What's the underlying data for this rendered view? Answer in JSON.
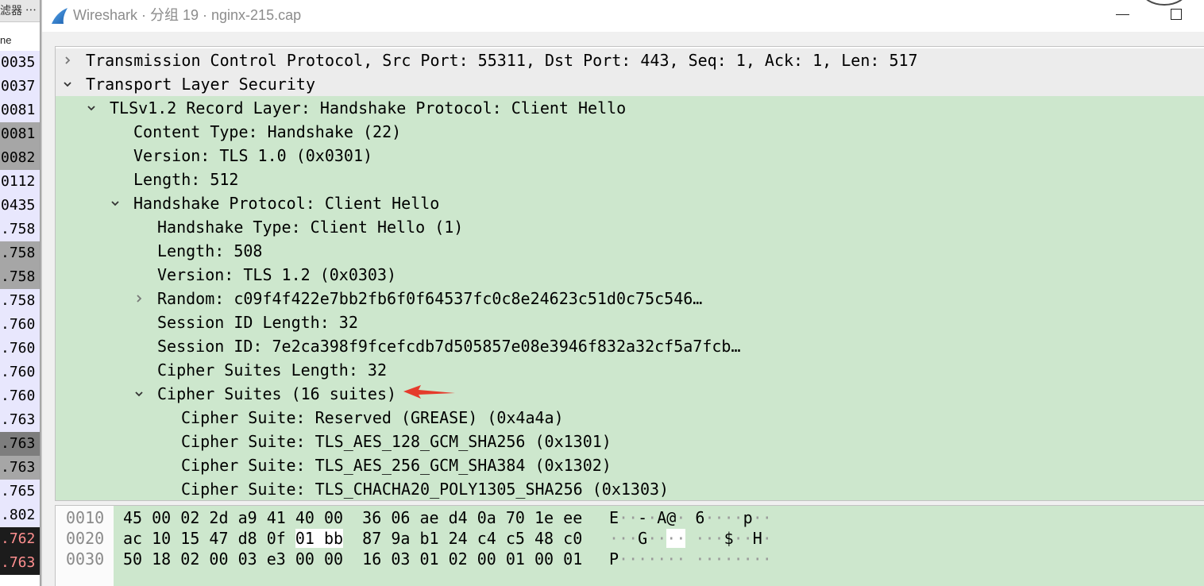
{
  "window": {
    "title": "Wireshark · 分组 19 · nginx-215.cap",
    "app_icon": "wireshark-fin-icon",
    "minimize_icon": "minimize-icon",
    "maximize_icon": "maximize-icon",
    "title_color": "#8c8c8c"
  },
  "background_window": {
    "filter_label": "滤器 ⋯",
    "column_header": "ne",
    "rows": [
      {
        "time": "0035",
        "bg": "#e8e7fd",
        "fg": "#000000"
      },
      {
        "time": "0037",
        "bg": "#e8e7fd",
        "fg": "#000000"
      },
      {
        "time": "0081",
        "bg": "#e8e7fd",
        "fg": "#000000"
      },
      {
        "time": "0081",
        "bg": "#a6a6a6",
        "fg": "#000000"
      },
      {
        "time": "0082",
        "bg": "#a6a6a6",
        "fg": "#000000"
      },
      {
        "time": "0112",
        "bg": "#e8e7fd",
        "fg": "#000000"
      },
      {
        "time": "0435",
        "bg": "#e8e7fd",
        "fg": "#000000"
      },
      {
        "time": ".758",
        "bg": "#e8e7fd",
        "fg": "#000000"
      },
      {
        "time": ".758",
        "bg": "#a6a6a6",
        "fg": "#000000"
      },
      {
        "time": ".758",
        "bg": "#a6a6a6",
        "fg": "#000000"
      },
      {
        "time": ".758",
        "bg": "#e8e7fd",
        "fg": "#000000"
      },
      {
        "time": ".760",
        "bg": "#e8e7fd",
        "fg": "#000000"
      },
      {
        "time": ".760",
        "bg": "#e8e7fd",
        "fg": "#000000"
      },
      {
        "time": ".760",
        "bg": "#e8e7fd",
        "fg": "#000000"
      },
      {
        "time": ".760",
        "bg": "#e8e7fd",
        "fg": "#000000"
      },
      {
        "time": ".763",
        "bg": "#e8e7fd",
        "fg": "#000000"
      },
      {
        "time": ".763",
        "bg": "#7d7d7d",
        "fg": "#000000"
      },
      {
        "time": ".763",
        "bg": "#a6a6a6",
        "fg": "#000000"
      },
      {
        "time": ".765",
        "bg": "#e8e7fd",
        "fg": "#000000"
      },
      {
        "time": ".802",
        "bg": "#e8e7fd",
        "fg": "#000000"
      },
      {
        "time": ".762",
        "bg": "#1c1c1c",
        "fg": "#ff8f8f"
      },
      {
        "time": ".763",
        "bg": "#1c1c1c",
        "fg": "#ff8f8f"
      }
    ]
  },
  "details": {
    "highlight_color": "#cde7cd",
    "rows": [
      {
        "text": "Transmission Control Protocol, Src Port: 55311, Dst Port: 443, Seq: 1, Ack: 1, Len: 517",
        "depth": 0,
        "expander": "collapsed",
        "highlighted": false
      },
      {
        "text": "Transport Layer Security",
        "depth": 0,
        "expander": "expanded",
        "highlighted": false
      },
      {
        "text": "TLSv1.2 Record Layer: Handshake Protocol: Client Hello",
        "depth": 1,
        "expander": "expanded",
        "highlighted": true
      },
      {
        "text": "Content Type: Handshake (22)",
        "depth": 2,
        "expander": null,
        "highlighted": true
      },
      {
        "text": "Version: TLS 1.0 (0x0301)",
        "depth": 2,
        "expander": null,
        "highlighted": true
      },
      {
        "text": "Length: 512",
        "depth": 2,
        "expander": null,
        "highlighted": true
      },
      {
        "text": "Handshake Protocol: Client Hello",
        "depth": 2,
        "expander": "expanded",
        "highlighted": true
      },
      {
        "text": "Handshake Type: Client Hello (1)",
        "depth": 3,
        "expander": null,
        "highlighted": true
      },
      {
        "text": "Length: 508",
        "depth": 3,
        "expander": null,
        "highlighted": true
      },
      {
        "text": "Version: TLS 1.2 (0x0303)",
        "depth": 3,
        "expander": null,
        "highlighted": true
      },
      {
        "text": "Random: c09f4f422e7bb2fb6f0f64537fc0c8e24623c51d0c75c546…",
        "depth": 3,
        "expander": "collapsed",
        "highlighted": true
      },
      {
        "text": "Session ID Length: 32",
        "depth": 3,
        "expander": null,
        "highlighted": true
      },
      {
        "text": "Session ID: 7e2ca398f9fcefcdb7d505857e08e3946f832a32cf5a7fcb…",
        "depth": 3,
        "expander": null,
        "highlighted": true
      },
      {
        "text": "Cipher Suites Length: 32",
        "depth": 3,
        "expander": null,
        "highlighted": true
      },
      {
        "text": "Cipher Suites (16 suites)",
        "depth": 3,
        "expander": "expanded",
        "highlighted": true
      },
      {
        "text": "Cipher Suite: Reserved (GREASE) (0x4a4a)",
        "depth": 4,
        "expander": null,
        "highlighted": true
      },
      {
        "text": "Cipher Suite: TLS_AES_128_GCM_SHA256 (0x1301)",
        "depth": 4,
        "expander": null,
        "highlighted": true
      },
      {
        "text": "Cipher Suite: TLS_AES_256_GCM_SHA384 (0x1302)",
        "depth": 4,
        "expander": null,
        "highlighted": true
      },
      {
        "text": "Cipher Suite: TLS_CHACHA20_POLY1305_SHA256 (0x1303)",
        "depth": 4,
        "expander": null,
        "highlighted": true
      }
    ]
  },
  "bytes": {
    "rows": [
      {
        "offset": "0010",
        "hex": [
          "45",
          "00",
          "02",
          "2d",
          "a9",
          "41",
          "40",
          "00",
          "36",
          "06",
          "ae",
          "d4",
          "0a",
          "70",
          "1e",
          "ee"
        ],
        "ascii": [
          "E",
          "·",
          "·",
          "-",
          "·",
          "A",
          "@",
          "·",
          "6",
          "·",
          "·",
          "·",
          "·",
          "p",
          "·",
          "·"
        ],
        "selected": []
      },
      {
        "offset": "0020",
        "hex": [
          "ac",
          "10",
          "15",
          "47",
          "d8",
          "0f",
          "01",
          "bb",
          "87",
          "9a",
          "b1",
          "24",
          "c4",
          "c5",
          "48",
          "c0"
        ],
        "ascii": [
          "·",
          "·",
          "·",
          "G",
          "·",
          "·",
          "·",
          "·",
          "·",
          "·",
          "·",
          "$",
          "·",
          "·",
          "H",
          "·"
        ],
        "selected": [
          6,
          7
        ]
      },
      {
        "offset": "0030",
        "hex": [
          "50",
          "18",
          "02",
          "00",
          "03",
          "e3",
          "00",
          "00",
          "16",
          "03",
          "01",
          "02",
          "00",
          "01",
          "00",
          "01"
        ],
        "ascii": [
          "P",
          "·",
          "·",
          "·",
          "·",
          "·",
          "·",
          "·",
          "·",
          "·",
          "·",
          "·",
          "·",
          "·",
          "·",
          "·"
        ],
        "selected": []
      }
    ]
  },
  "annotation": {
    "arrow_color": "#e53b2c"
  }
}
